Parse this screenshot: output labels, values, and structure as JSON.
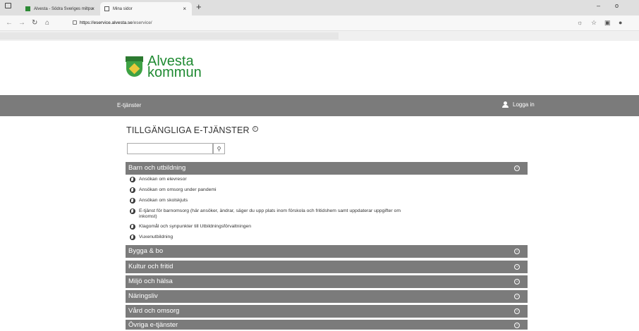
{
  "browser": {
    "tabs": [
      {
        "label": "Alvesta - Södra Sveriges miltpu",
        "active": false
      },
      {
        "label": "Mina sidor",
        "active": true
      }
    ],
    "url_host": "https://eservice.alvesta.se",
    "url_path": "/eservice/",
    "new_tab_symbol": "+",
    "close_symbol": "×",
    "minimize_symbol": "–",
    "maximize_symbol": "o"
  },
  "site": {
    "logo_line1": "Alvesta",
    "logo_line2": "kommun",
    "nav_etjanster": "E-tjänster",
    "login_label": "Logga in",
    "heading": "TILLGÄNGLIGA E-TJÄNSTER",
    "colors": {
      "band": "#7b7b7b",
      "logo_green": "#1f8a32"
    }
  },
  "categories": [
    {
      "label": "Barn och utbildning",
      "expanded": true
    },
    {
      "label": "Bygga & bo"
    },
    {
      "label": "Kultur och fritid"
    },
    {
      "label": "Miljö och hälsa"
    },
    {
      "label": "Näringsliv"
    },
    {
      "label": "Vård och omsorg"
    },
    {
      "label": "Övriga e-tjänster"
    }
  ],
  "services": [
    "Ansökan om elevresor",
    "Ansökan om omsorg under pandemi",
    "Ansökan om skolskjuts",
    "E-tjänst för barnomsorg (här ansöker, ändrar, säger du upp plats inom förskola och fritidshem samt uppdaterar uppgifter om inkomst)",
    "Klagomål och synpunkter till Utbildningsförvaltningen",
    "Vuxenutbildning"
  ]
}
